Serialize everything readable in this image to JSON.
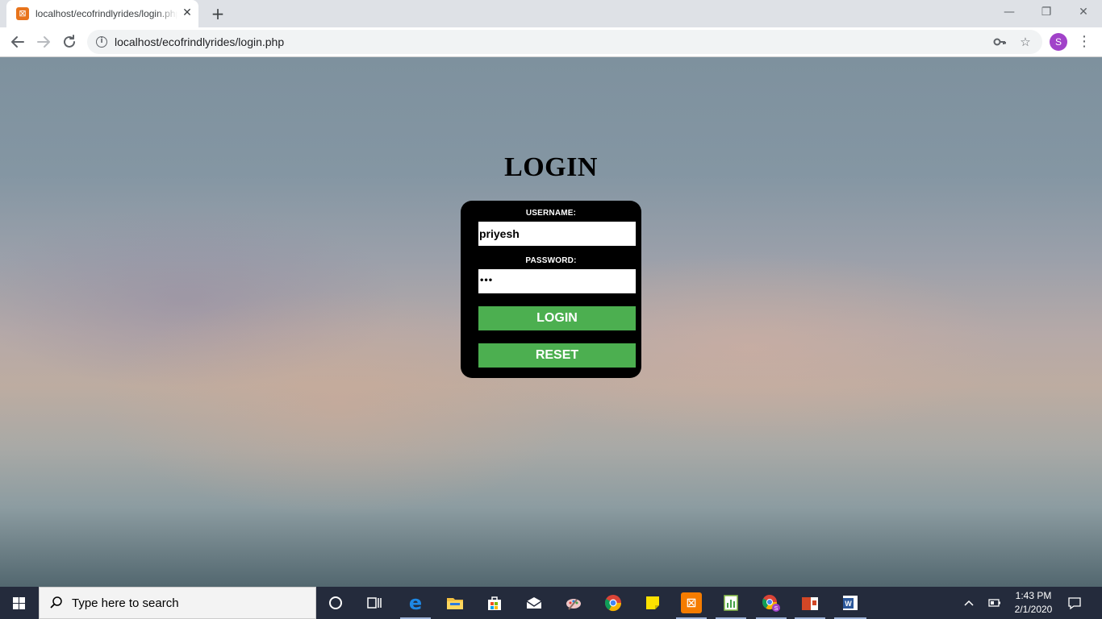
{
  "browser": {
    "tab_title": "localhost/ecofrindlyrides/login.php",
    "url": "localhost/ecofrindlyrides/login.php",
    "new_tab_glyph": "+",
    "tab_close_glyph": "✕",
    "profile_initial": "S",
    "window_controls": {
      "minimize": "—",
      "restore": "❐",
      "close": "✕"
    },
    "icons": {
      "favicon": "xampp-icon",
      "back": "back-arrow-icon",
      "forward": "forward-arrow-icon",
      "reload": "reload-icon",
      "info": "info-icon",
      "key": "key-icon",
      "star": "star-icon",
      "menu": "more-vert-icon"
    }
  },
  "page": {
    "title": "LOGIN",
    "form": {
      "username_label": "USERNAME:",
      "username_value": "priyesh",
      "password_label": "PASSWORD:",
      "password_masked": "•••",
      "login_button": "LOGIN",
      "reset_button": "RESET"
    },
    "colors": {
      "form_bg": "#000000",
      "button_bg": "#4caf50",
      "button_text": "#ffffff"
    }
  },
  "taskbar": {
    "search_placeholder": "Type here to search",
    "time": "1:43 PM",
    "date": "2/1/2020",
    "apps": [
      "cortana-icon",
      "task-view-icon",
      "edge-icon",
      "file-explorer-icon",
      "store-icon",
      "mail-icon",
      "paint-icon",
      "chrome-icon",
      "sticky-notes-icon",
      "xampp-icon",
      "sheets-icon",
      "chrome-profile-icon",
      "powerpoint-icon",
      "word-icon"
    ],
    "tray": [
      "chevron-up-icon",
      "battery-icon",
      "notification-icon"
    ]
  }
}
